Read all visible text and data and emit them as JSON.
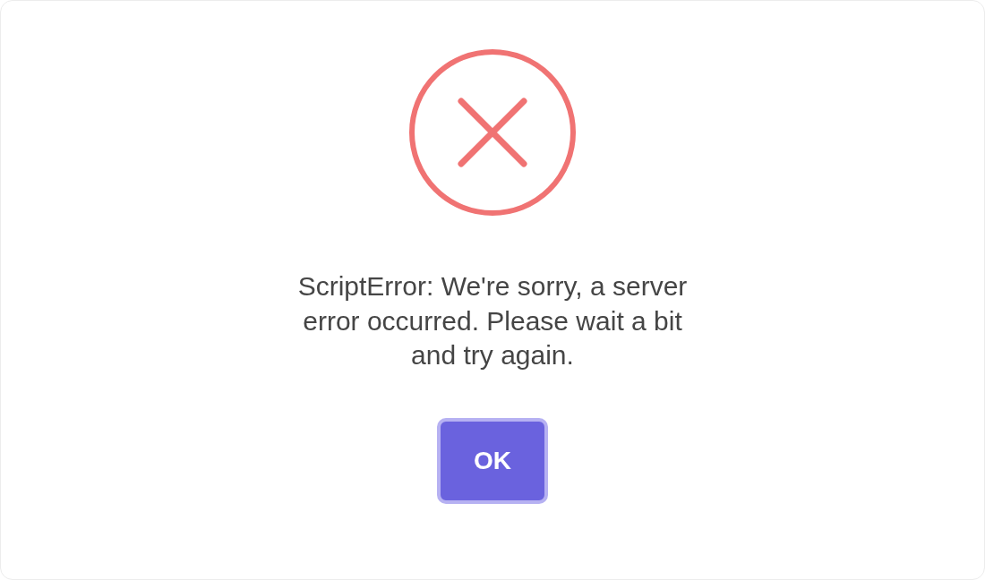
{
  "dialog": {
    "message": "ScriptError: We're sorry, a server error occurred. Please wait a bit and try again.",
    "button": "OK"
  }
}
